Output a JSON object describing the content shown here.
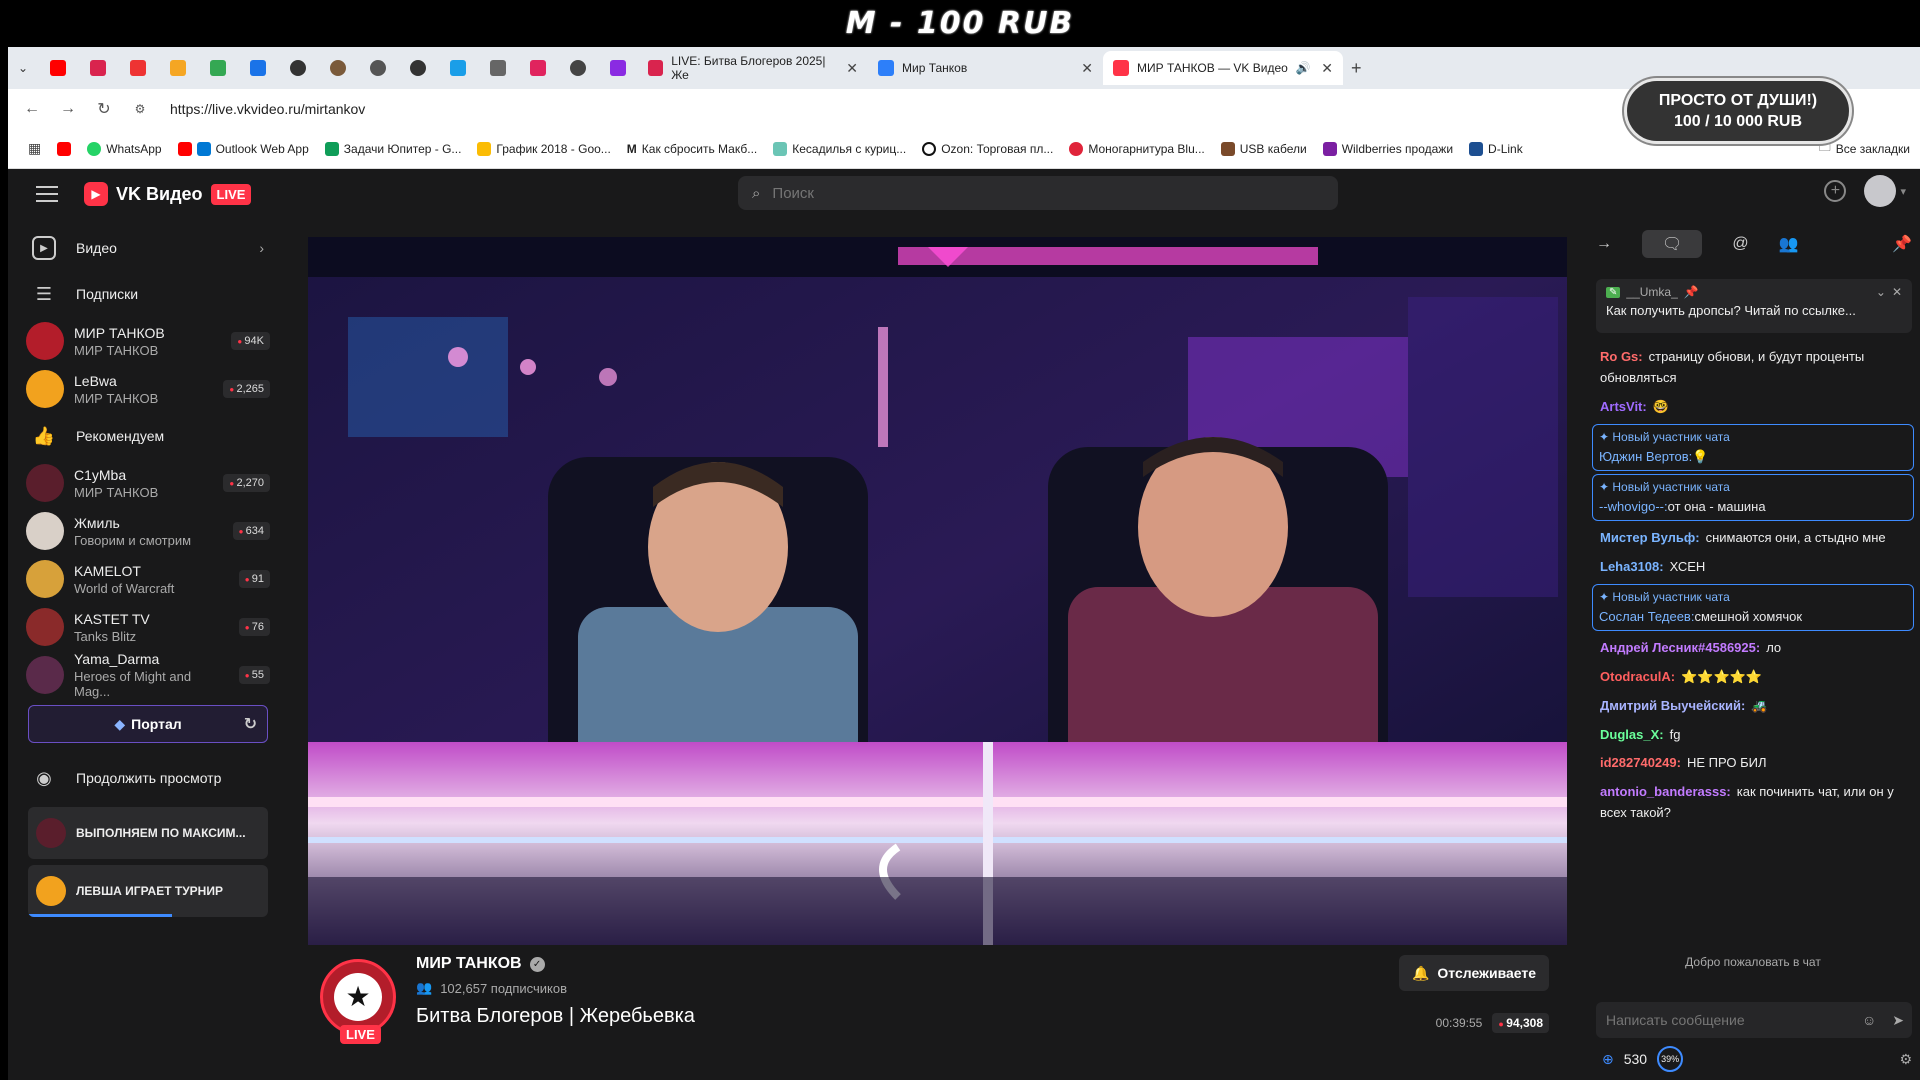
{
  "overlay": {
    "banner": "M - 100 RUB",
    "donation_line1": "ПРОСТО ОТ ДУШИ!)",
    "donation_line2": "100 / 10 000 RUB"
  },
  "browser": {
    "tabs": [
      {
        "title": "LIVE: Битва Блогеров 2025| Же",
        "color": "#d9244e"
      },
      {
        "title": "Мир Танков",
        "color": "#2d7ff9"
      },
      {
        "title": "МИР ТАНКОВ — VK Видео",
        "color": "#ff3347"
      }
    ],
    "url": "https://live.vkvideo.ru/mirtankov",
    "bookmarks": [
      "WhatsApp",
      "Outlook Web App",
      "Задачи Юпитер - G...",
      "График 2018 - Goo...",
      "Как сбросить Макб...",
      "Кесадилья с куриц...",
      "Ozon: Торговая пл...",
      "Моногарнитура Blu...",
      "USB кабели",
      "Wildberries продажи",
      "D-Link"
    ],
    "all_bookmarks": "Все закладки"
  },
  "header": {
    "logo": "VK Видео",
    "live_badge": "LIVE",
    "search_placeholder": "Поиск"
  },
  "sidebar": {
    "video": "Видео",
    "subscriptions": "Подписки",
    "subs_channels": [
      {
        "name": "МИР ТАНКОВ",
        "sub": "МИР ТАНКОВ",
        "count": "94K",
        "color": "#b31d2a"
      },
      {
        "name": "LeBwa",
        "sub": "МИР ТАНКОВ",
        "count": "2,265",
        "color": "#f2a21e"
      }
    ],
    "recommended": "Рекомендуем",
    "rec_channels": [
      {
        "name": "C1yMba",
        "sub": "МИР ТАНКОВ",
        "count": "2,270",
        "color": "#5a1e2c"
      },
      {
        "name": "Жмиль",
        "sub": "Говорим и смотрим",
        "count": "634",
        "color": "#d9d0c8"
      },
      {
        "name": "KAMELOT",
        "sub": "World of Warcraft",
        "count": "91",
        "color": "#d7a13a"
      },
      {
        "name": "KASTET TV",
        "sub": "Tanks Blitz",
        "count": "76",
        "color": "#8a2a2a"
      },
      {
        "name": "Yama_Darma",
        "sub": "Heroes of Might and Mag...",
        "count": "55",
        "color": "#5a2a4a"
      }
    ],
    "portal": "Портал",
    "continue": "Продолжить просмотр",
    "continue_items": [
      {
        "title": "ВЫПОЛНЯЕМ ПО МАКСИМ...",
        "color": "#5a1e2c",
        "progress": 0
      },
      {
        "title": "ЛЕВША ИГРАЕТ ТУРНИР",
        "color": "#f2a21e",
        "progress": 0.6
      }
    ]
  },
  "stream": {
    "channel": "МИР ТАНКОВ",
    "subscribers": "102,657 подписчиков",
    "title": "Битва Блогеров | Жеребьевка",
    "follow_button": "Отслеживаете",
    "elapsed": "00:39:55",
    "viewers": "94,308",
    "live_badge": "LIVE"
  },
  "chat": {
    "pinned_user": "__Umka_",
    "pinned_text": "Как получить дропсы? Читай по ссылке...",
    "messages": [
      {
        "type": "msg",
        "user": "Ro Gs:",
        "color": "#ff6b6b",
        "text": "страницу обнови, и будут проценты обновляться"
      },
      {
        "type": "msg",
        "user": "ArtsVit:",
        "color": "#a06bff",
        "text": "🤓"
      },
      {
        "type": "sys",
        "title": "Новый участник чата",
        "user": "Юджин Вертов:",
        "color": "#7ab4ff",
        "text": "💡"
      },
      {
        "type": "sys",
        "title": "Новый участник чата",
        "user": "--whovigo--:",
        "color": "#7ab4ff",
        "text": "от она - машина"
      },
      {
        "type": "msg",
        "user": "Мистер Вульф:",
        "color": "#7ab4ff",
        "text": "снимаются они, а стыдно мне"
      },
      {
        "type": "msg",
        "user": "Leha3108:",
        "color": "#7ab4ff",
        "text": "ХСЕН"
      },
      {
        "type": "sys",
        "title": "Новый участник чата",
        "user": "Сослан Тедеев:",
        "color": "#7ab4ff",
        "text": "смешной хомячок"
      },
      {
        "type": "msg",
        "user": "Андрей Лесник#4586925:",
        "color": "#c27bff",
        "text": "ло"
      },
      {
        "type": "msg",
        "user": "OtodraculA:",
        "color": "#ff5f5f",
        "text": "⭐⭐⭐⭐⭐"
      },
      {
        "type": "msg",
        "user": "Дмитрий Выучейский:",
        "color": "#a9b4ff",
        "text": "🚜"
      },
      {
        "type": "msg",
        "user": "Duglas_X:",
        "color": "#6bff9b",
        "text": "fg"
      },
      {
        "type": "msg",
        "user": "id282740249:",
        "color": "#ff6b6b",
        "text": "НЕ ПРО БИЛ"
      },
      {
        "type": "msg",
        "user": "antonio_banderasss:",
        "color": "#c27bff",
        "text": "как починить чат, или он у всех такой?"
      }
    ],
    "welcome": "Добро пожаловать в чат",
    "input_placeholder": "Написать сообщение",
    "points": "530",
    "progress": "39%"
  }
}
